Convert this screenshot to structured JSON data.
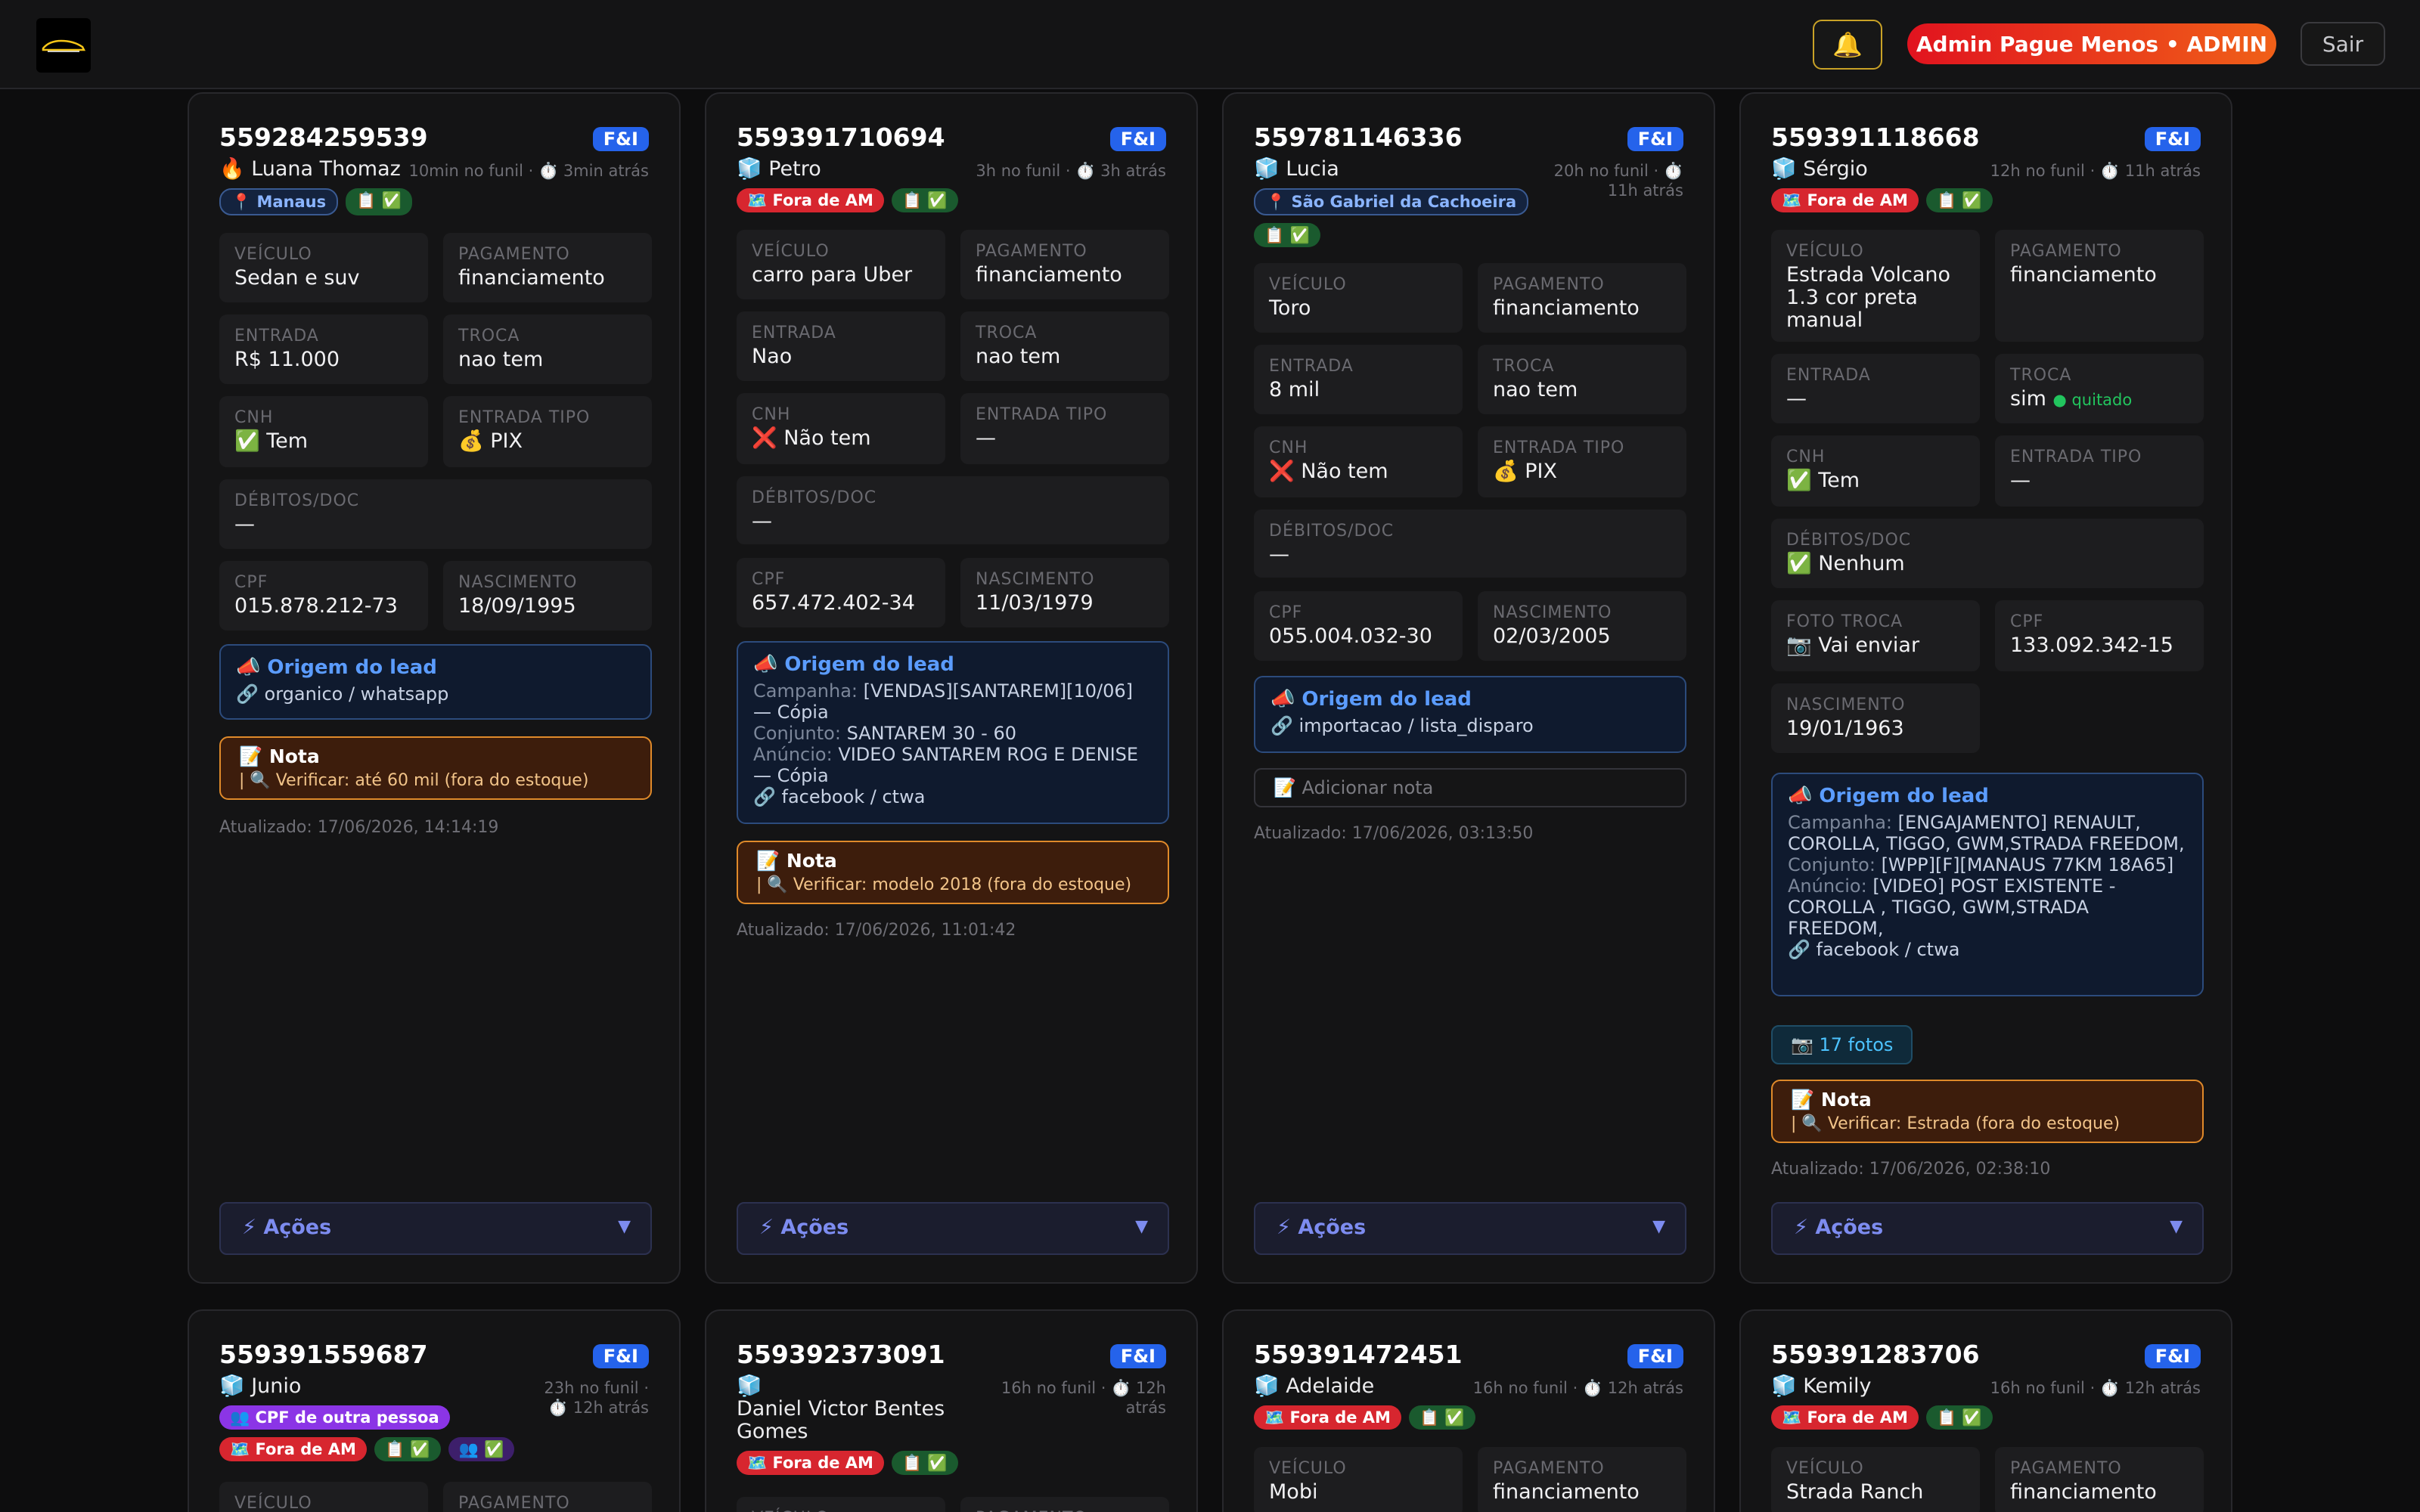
{
  "header": {
    "bell_icon": "🔔",
    "admin_label": "Admin Pague Menos • ADMIN",
    "logout_label": "Sair"
  },
  "labels": {
    "badge": "F&I",
    "veiculo": "VEÍCULO",
    "pagamento": "PAGAMENTO",
    "entrada": "ENTRADA",
    "troca": "TROCA",
    "cnh": "CNH",
    "entrada_tipo": "ENTRADA TIPO",
    "debitos": "DÉBITOS/DOC",
    "cpf": "CPF",
    "nascimento": "NASCIMENTO",
    "foto_troca": "FOTO TROCA",
    "origem": "📣 Origem do lead",
    "campanha": "Campanha: ",
    "conjunto": "Conjunto: ",
    "anuncio": "Anúncio: ",
    "nota": "📝 Nota",
    "add_nota": "📝 Adicionar nota",
    "acoes": "⚡ Ações",
    "chevron": "▼"
  },
  "cards": [
    {
      "phone": "559284259539",
      "name": "🔥 Luana Thomaz",
      "time": "10min no funil · ⏱️ 3min atrás",
      "tag_city": "📍 Manaus",
      "tag_ok": "📋 ✅",
      "veiculo": "Sedan e suv",
      "pagamento": "financiamento",
      "entrada": "R$ 11.000",
      "troca": "nao tem",
      "cnh": "✅ Tem",
      "entrada_tipo": "💰 PIX",
      "debitos": "—",
      "cpf": "015.878.212-73",
      "nascimento": "18/09/1995",
      "origem_link": "🔗 organico / whatsapp",
      "nota": "| 🔍 Verificar: até 60 mil (fora do estoque)",
      "updated": "Atualizado: 17/06/2026, 14:14:19"
    },
    {
      "phone": "559391710694",
      "name": "🧊 Petro",
      "time": "3h no funil · ⏱️ 3h atrás",
      "tag_fora": "🗺️ Fora de AM",
      "tag_ok": "📋 ✅",
      "veiculo": "carro para Uber",
      "pagamento": "financiamento",
      "entrada": "Nao",
      "troca": "nao tem",
      "cnh": "❌ Não tem",
      "entrada_tipo": "—",
      "debitos": "—",
      "cpf": "657.472.402-34",
      "nascimento": "11/03/1979",
      "campanha": "[VENDAS][SANTAREM][10/06] — Cópia",
      "conjunto": "SANTAREM 30 - 60",
      "anuncio": "VIDEO SANTAREM ROG E DENISE — Cópia",
      "origem_link": "🔗 facebook / ctwa",
      "nota": "| 🔍 Verificar: modelo 2018 (fora do estoque)",
      "updated": "Atualizado: 17/06/2026, 11:01:42"
    },
    {
      "phone": "559781146336",
      "name": "🧊 Lucia",
      "time": "20h no funil · ⏱️ 11h atrás",
      "tag_city": "📍 São Gabriel da Cachoeira",
      "tag_ok": "📋 ✅",
      "veiculo": "Toro",
      "pagamento": "financiamento",
      "entrada": "8 mil",
      "troca": "nao tem",
      "cnh": "❌ Não tem",
      "entrada_tipo": "💰 PIX",
      "debitos": "—",
      "cpf": "055.004.032-30",
      "nascimento": "02/03/2005",
      "origem_link": "🔗 importacao / lista_disparo",
      "updated": "Atualizado: 17/06/2026, 03:13:50"
    },
    {
      "phone": "559391118668",
      "name": "🧊 Sérgio",
      "time": "12h no funil · ⏱️ 11h atrás",
      "tag_fora": "🗺️ Fora de AM",
      "tag_ok": "📋 ✅",
      "veiculo": "Estrada Volcano 1.3 cor preta manual",
      "pagamento": "financiamento",
      "entrada": "—",
      "troca": "sim",
      "troca_status": "● quitado",
      "cnh": "✅ Tem",
      "entrada_tipo": "—",
      "debitos": "✅ Nenhum",
      "foto_troca": "📷 Vai enviar",
      "cpf": "133.092.342-15",
      "nascimento": "19/01/1963",
      "campanha": "[ENGAJAMENTO] RENAULT, COROLLA, TIGGO, GWM,STRADA FREEDOM,",
      "conjunto": "[WPP][F][MANAUS 77KM 18A65]",
      "anuncio": "[VIDEO] POST EXISTENTE - COROLLA , TIGGO, GWM,STRADA FREEDOM,",
      "origem_link": "🔗 facebook / ctwa",
      "fotos": "📷 17 fotos",
      "nota": "| 🔍 Verificar: Estrada (fora do estoque)",
      "updated": "Atualizado: 17/06/2026, 02:38:10"
    },
    {
      "phone": "559391559687",
      "name": "🧊 Junio",
      "time_a": "23h no funil ·",
      "time_b": "⏱️ 12h atrás",
      "tag_cpf": "👥 CPF de outra pessoa",
      "tag_fora": "🗺️ Fora de AM",
      "tag_ok": "📋 ✅",
      "tag_ppl": "👥 ✅"
    },
    {
      "phone": "559392373091",
      "name_icon": "🧊",
      "name": "Daniel Victor Bentes Gomes",
      "time_a": "16h no funil · ⏱️ 12h",
      "time_b": "atrás",
      "tag_fora": "🗺️ Fora de AM",
      "tag_ok": "📋 ✅"
    },
    {
      "phone": "559391472451",
      "name": "🧊 Adelaide",
      "time": "16h no funil · ⏱️ 12h atrás",
      "tag_fora": "🗺️ Fora de AM",
      "tag_ok": "📋 ✅",
      "veiculo": "Mobi",
      "pagamento": "financiamento"
    },
    {
      "phone": "559391283706",
      "name": "🧊 Kemily",
      "time": "16h no funil · ⏱️ 12h atrás",
      "tag_fora": "🗺️ Fora de AM",
      "tag_ok": "📋 ✅",
      "veiculo": "Strada Ranch",
      "pagamento": "financiamento"
    }
  ]
}
